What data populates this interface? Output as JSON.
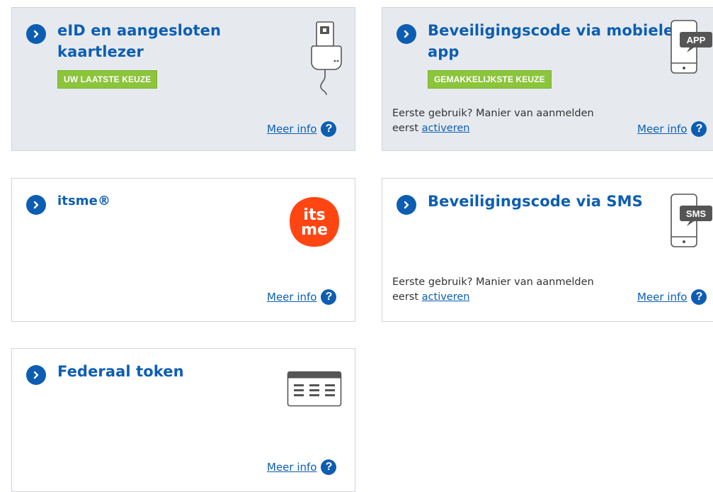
{
  "cards": {
    "eid": {
      "title_line1": "eID en aangesloten",
      "title_line2": "kaartlezer",
      "badge": "UW LAATSTE KEUZE",
      "more_info": "Meer info",
      "icon": "card-reader-icon"
    },
    "mobile_app": {
      "title_line1": "Beveiligingscode via mobiele",
      "title_line2": "app",
      "badge": "GEMAKKELIJKSTE KEUZE",
      "note_line1": "Eerste gebruik? Manier van aanmelden",
      "note_prefix": "eerst",
      "note_link": "activeren",
      "more_info": "Meer info",
      "icon_label": "APP"
    },
    "itsme": {
      "title": "itsme®",
      "logo_top": "its",
      "logo_bottom": "me",
      "more_info": "Meer info"
    },
    "sms": {
      "title": "Beveiligingscode via SMS",
      "note_line1": "Eerste gebruik? Manier van aanmelden",
      "note_prefix": "eerst",
      "note_link": "activeren",
      "more_info": "Meer info",
      "icon_label": "SMS"
    },
    "token": {
      "title": "Federaal token",
      "more_info": "Meer info",
      "icon": "token-card-icon"
    }
  },
  "help_glyph": "?",
  "colors": {
    "accent": "#0d5eb2",
    "badge_green": "#8cc43c",
    "shaded_card": "#e6eaef",
    "itsme_orange": "#ff4612"
  }
}
